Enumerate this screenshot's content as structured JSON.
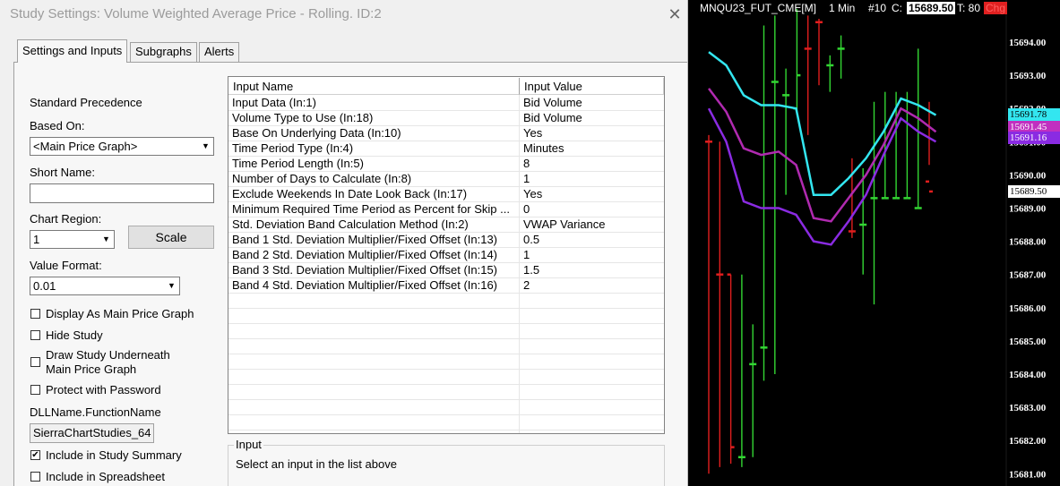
{
  "dialog": {
    "title": "Study Settings: Volume Weighted Average Price - Rolling. ID:2",
    "tabs": [
      "Settings and Inputs",
      "Subgraphs",
      "Alerts"
    ],
    "standard_precedence": "Standard Precedence",
    "based_on_label": "Based On:",
    "based_on_value": "<Main Price Graph>",
    "short_name_label": "Short Name:",
    "short_name_value": "",
    "chart_region_label": "Chart Region:",
    "chart_region_value": "1",
    "scale_button": "Scale",
    "value_format_label": "Value Format:",
    "value_format_value": "0.01",
    "checkboxes": [
      {
        "label": "Display As Main Price Graph",
        "checked": false
      },
      {
        "label": "Hide Study",
        "checked": false
      },
      {
        "label": "Draw Study Underneath",
        "label2": "Main Price Graph",
        "checked": false
      },
      {
        "label": "Protect with Password",
        "checked": false
      }
    ],
    "dll_label": "DLLName.FunctionName",
    "dll_value": "SierraChartStudies_64",
    "checkboxes_bottom": [
      {
        "label": "Include in Study Summary",
        "checked": true
      },
      {
        "label": "Include in Spreadsheet",
        "checked": false
      }
    ],
    "table": {
      "headers": [
        "Input Name",
        "Input Value"
      ],
      "rows": [
        {
          "name": "Input Data   (In:1)",
          "value": "Bid Volume"
        },
        {
          "name": "Volume Type to Use   (In:18)",
          "value": "Bid Volume"
        },
        {
          "name": "Base On Underlying Data   (In:10)",
          "value": "Yes"
        },
        {
          "name": "Time Period Type   (In:4)",
          "value": "Minutes"
        },
        {
          "name": "Time Period Length   (In:5)",
          "value": "8"
        },
        {
          "name": "Number of Days to Calculate   (In:8)",
          "value": "1"
        },
        {
          "name": "Exclude Weekends In Date Look Back   (In:17)",
          "value": "Yes"
        },
        {
          "name": "Minimum Required Time Period as Percent for Skip ...",
          "value": "0"
        },
        {
          "name": "Std. Deviation Band Calculation Method   (In:2)",
          "value": "VWAP Variance"
        },
        {
          "name": "Band 1 Std. Deviation Multiplier/Fixed Offset   (In:13)",
          "value": "0.5"
        },
        {
          "name": "Band 2 Std. Deviation Multiplier/Fixed Offset   (In:14)",
          "value": "1"
        },
        {
          "name": "Band 3 Std. Deviation Multiplier/Fixed Offset   (In:15)",
          "value": "1.5"
        },
        {
          "name": "Band 4 Std. Deviation Multiplier/Fixed Offset   (In:16)",
          "value": "2"
        }
      ]
    },
    "input_group_title": "Input",
    "input_help": "Select an input in the list above"
  },
  "chart": {
    "header": {
      "symbol": "MNQU23_FUT_CME[M]",
      "timeframe": "1 Min",
      "bar_count": "#10",
      "close_label": "C:",
      "close_value": "15689.50",
      "ticks_label": "T: 80",
      "last": "Chg"
    },
    "price_tags": [
      {
        "value": "15691.78",
        "color": "#33e6f0"
      },
      {
        "value": "15691.45",
        "color": "#c030c0"
      },
      {
        "value": "15691.16",
        "color": "#8a2be2"
      },
      {
        "value": "15689.50",
        "color": "#ffffff"
      }
    ],
    "colors": {
      "up": "#33d633",
      "down": "#e01e1e",
      "vwap": "#33e6f0",
      "band1": "#b02ab0",
      "band2": "#8a2be2"
    }
  },
  "chart_data": {
    "type": "line",
    "title": "",
    "y_ticks": [
      "15694.00",
      "15693.00",
      "15692.00",
      "15691.00",
      "15690.00",
      "15689.00",
      "15688.00",
      "15687.00",
      "15686.00",
      "15685.00",
      "15684.00",
      "15683.00",
      "15682.00",
      "15681.00"
    ],
    "ylim": [
      15680.8,
      15695.3
    ],
    "bars": [
      {
        "high": 15691.2,
        "low": 15681.0,
        "open": 15691.0,
        "close": 15691.0,
        "dir": "down"
      },
      {
        "high": 15691.0,
        "low": 15681.2,
        "open": 15687.0,
        "close": 15687.0,
        "dir": "down"
      },
      {
        "high": 15687.0,
        "low": 15681.3,
        "open": 15687.0,
        "close": 15681.8,
        "dir": "down"
      },
      {
        "high": 15687.0,
        "low": 15681.2,
        "open": 15681.5,
        "close": 15681.5,
        "dir": "up"
      },
      {
        "high": 15685.5,
        "low": 15681.5,
        "open": 15684.3,
        "close": 15684.3,
        "dir": "up"
      },
      {
        "high": 15694.5,
        "low": 15683.8,
        "open": 15684.8,
        "close": 15684.8,
        "dir": "up"
      },
      {
        "high": 15694.8,
        "low": 15684.0,
        "open": 15692.8,
        "close": 15692.8,
        "dir": "up"
      },
      {
        "high": 15693.2,
        "low": 15689.4,
        "open": 15692.4,
        "close": 15692.4,
        "dir": "up"
      },
      {
        "high": 15695.0,
        "low": 15691.8,
        "open": 15692.0,
        "close": 15693.0,
        "dir": "up"
      },
      {
        "high": 15694.8,
        "low": 15691.2,
        "open": 15693.8,
        "close": 15693.8,
        "dir": "down"
      },
      {
        "high": 15694.7,
        "low": 15692.7,
        "open": 15694.6,
        "close": 15694.6,
        "dir": "down"
      },
      {
        "high": 15693.6,
        "low": 15692.5,
        "open": 15693.3,
        "close": 15693.3,
        "dir": "up"
      },
      {
        "high": 15694.2,
        "low": 15692.9,
        "open": 15693.8,
        "close": 15693.8,
        "dir": "up"
      },
      {
        "high": 15690.5,
        "low": 15688.1,
        "open": 15688.3,
        "close": 15688.3,
        "dir": "down"
      },
      {
        "high": 15690.2,
        "low": 15687.0,
        "open": 15688.5,
        "close": 15688.5,
        "dir": "up"
      },
      {
        "high": 15692.2,
        "low": 15686.1,
        "open": 15689.3,
        "close": 15689.3,
        "dir": "up"
      },
      {
        "high": 15692.5,
        "low": 15689.3,
        "open": 15689.3,
        "close": 15689.3,
        "dir": "up"
      },
      {
        "high": 15692.5,
        "low": 15689.3,
        "open": 15689.3,
        "close": 15689.3,
        "dir": "up"
      },
      {
        "high": 15692.5,
        "low": 15689.3,
        "open": 15689.3,
        "close": 15689.3,
        "dir": "up"
      },
      {
        "high": 15693.8,
        "low": 15689.0,
        "open": 15689.0,
        "close": 15689.0,
        "dir": "up"
      },
      {
        "high": 15692.2,
        "low": 15690.3,
        "open": 15689.8,
        "close": 15689.5,
        "dir": "down"
      }
    ],
    "series": [
      {
        "name": "VWAP",
        "values": [
          15693.7,
          15693.3,
          15692.4,
          15692.1,
          15692.1,
          15692.0,
          15689.4,
          15689.4,
          15689.9,
          15690.5,
          15691.3,
          15692.3,
          15692.1,
          15691.8
        ]
      },
      {
        "name": "Band 1",
        "values": [
          15692.6,
          15691.9,
          15690.8,
          15690.6,
          15690.7,
          15690.3,
          15688.7,
          15688.6,
          15689.3,
          15690.0,
          15690.9,
          15692.0,
          15691.7,
          15691.3
        ]
      },
      {
        "name": "Band 2",
        "values": [
          15692.0,
          15691.0,
          15689.2,
          15689.0,
          15689.0,
          15688.8,
          15688.0,
          15687.9,
          15688.6,
          15689.4,
          15690.6,
          15691.7,
          15691.3,
          15691.0
        ]
      }
    ]
  }
}
